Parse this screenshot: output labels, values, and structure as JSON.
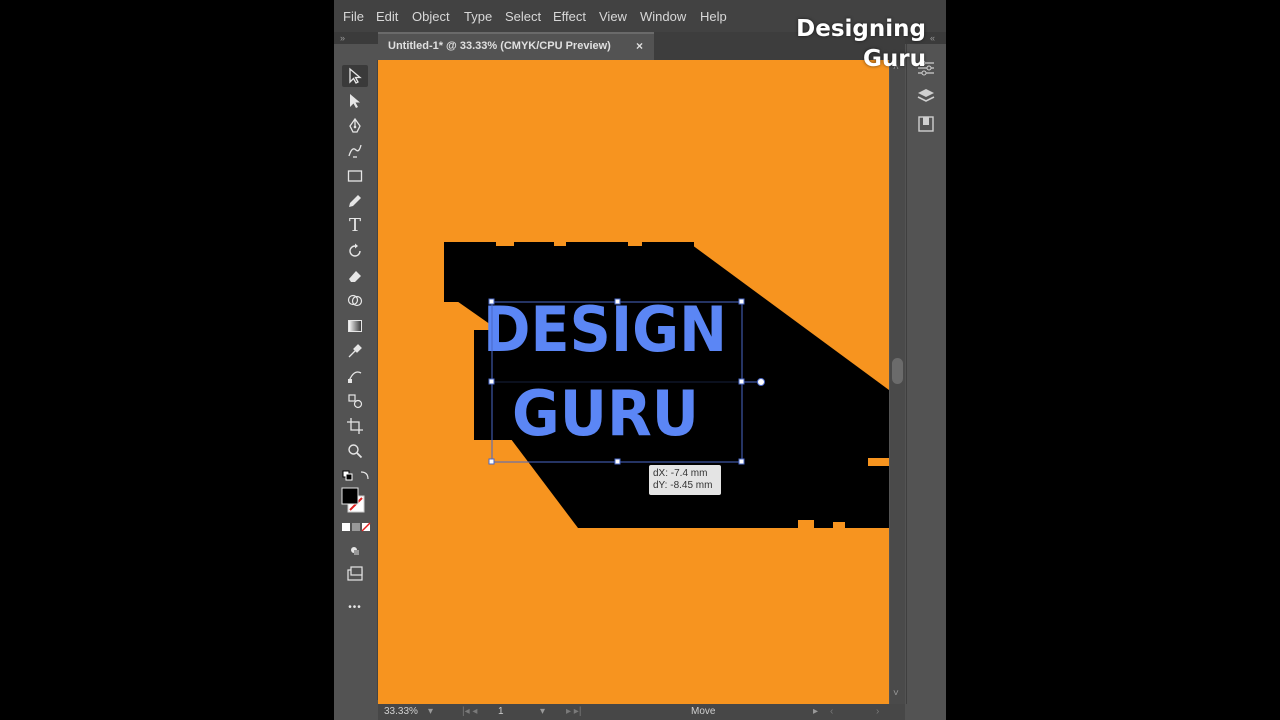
{
  "menubar": {
    "items": [
      "File",
      "Edit",
      "Object",
      "Type",
      "Select",
      "Effect",
      "View",
      "Window",
      "Help"
    ]
  },
  "document_tab": {
    "title": "Untitled-1* @ 33.33% (CMYK/CPU Preview)",
    "close_glyph": "×"
  },
  "tools": [
    "selection-tool",
    "direct-selection-tool",
    "pen-tool",
    "curvature-tool",
    "rectangle-tool",
    "pencil-tool",
    "type-tool",
    "rotate-tool",
    "eraser-tool",
    "shape-builder-tool",
    "gradient-tool",
    "eyedropper-tool",
    "blend-tool",
    "symbol-sprayer-tool",
    "artboard-tool",
    "zoom-tool"
  ],
  "tool_glyphs": {
    "type": "T",
    "more": "•••"
  },
  "artwork": {
    "line1": "DESIGN",
    "line2": "GURU",
    "fill_color": "#5b86f5",
    "shadow_color": "#000000",
    "background_color": "#f7941f"
  },
  "move_tooltip": {
    "dx": "dX: -7.4 mm",
    "dy": "dY: -8.45 mm"
  },
  "statusbar": {
    "zoom": "33.33%",
    "artboard_number": "1",
    "tool_name": "Move"
  },
  "watermark": {
    "line1": "Designing",
    "line2": "Guru"
  },
  "right_panel": [
    "properties-icon",
    "layers-icon",
    "libraries-icon"
  ]
}
